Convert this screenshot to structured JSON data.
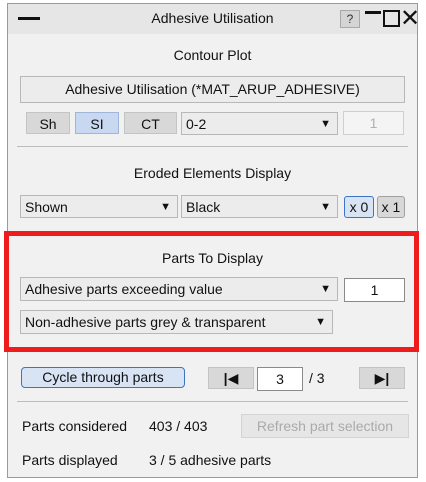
{
  "window": {
    "title": "Adhesive Utilisation",
    "help_label": "?",
    "close_glyph": "✕"
  },
  "contour_plot": {
    "heading": "Contour Plot",
    "component": "Adhesive Utilisation (*MAT_ARUP_ADHESIVE)",
    "buttons": [
      "Sh",
      "SI",
      "CT"
    ],
    "range_value": "0-2",
    "range_input": "1"
  },
  "eroded": {
    "heading": "Eroded Elements Display",
    "display_value": "Shown",
    "color_value": "Black",
    "toggles": [
      "x 0",
      "x 1"
    ]
  },
  "parts_to_display": {
    "heading": "Parts To Display",
    "filter_value": "Adhesive parts exceeding value",
    "threshold": "1",
    "non_adhesive_value": "Non-adhesive parts grey & transparent"
  },
  "cycle": {
    "button_label": "Cycle through parts",
    "first_icon": "skip-first-icon",
    "last_icon": "skip-last-icon",
    "current": "3",
    "total": "/ 3"
  },
  "status": {
    "considered_label": "Parts considered",
    "considered_value": "403 / 403",
    "refresh_label": "Refresh part selection",
    "displayed_label": "Parts displayed",
    "displayed_value": "3 / 5 adhesive parts"
  },
  "colors": {
    "highlight": "#ee1c1c",
    "accent": "#3e74c4"
  }
}
